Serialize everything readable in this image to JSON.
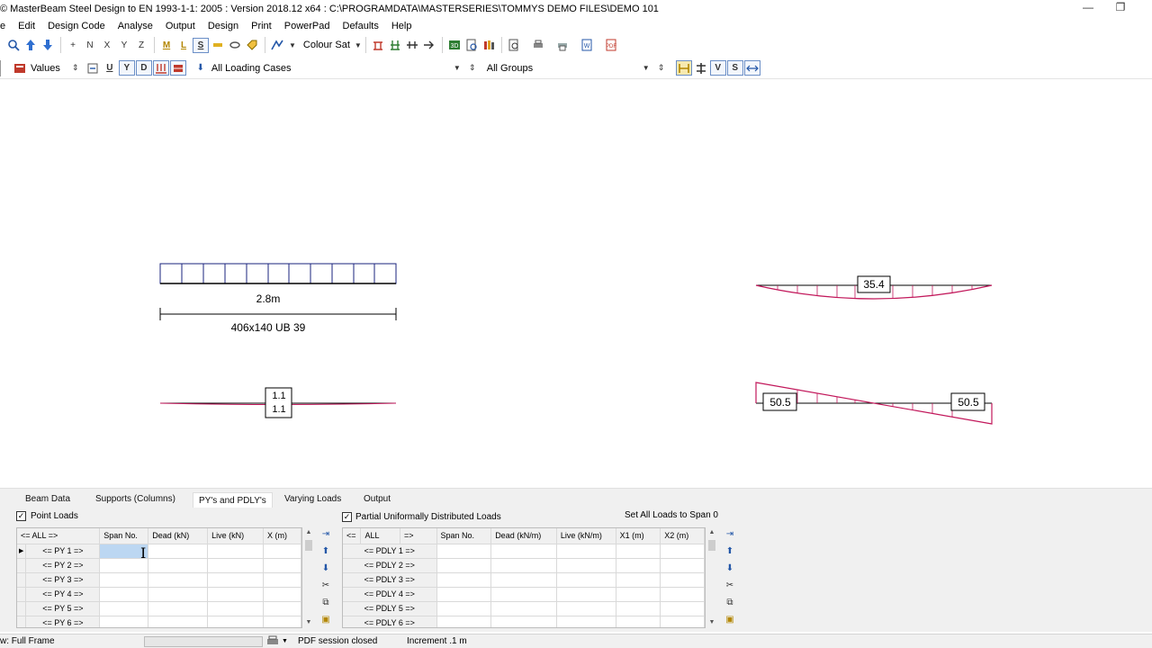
{
  "window": {
    "title": "© MasterBeam Steel Design to EN 1993-1-1: 2005 : Version 2018.12 x64 : C:\\PROGRAMDATA\\MASTERSERIES\\TOMMYS DEMO FILES\\DEMO 101",
    "minimize": "—",
    "restore": "❐"
  },
  "menu": [
    "e",
    "Edit",
    "Design Code",
    "Analyse",
    "Output",
    "Design",
    "Print",
    "PowerPad",
    "Defaults",
    "Help"
  ],
  "toolbar1": {
    "items_text": [
      "+",
      "N",
      "X",
      "Y",
      "Z",
      "M",
      "L",
      "S"
    ],
    "colour_label": "Colour Sat"
  },
  "toolbar2": {
    "values_label": "Values",
    "u": "U",
    "y": "Y",
    "d": "D",
    "loading_cases": "All Loading Cases",
    "groups": "All Groups",
    "v": "V",
    "s": "S"
  },
  "drawing": {
    "span_length": "2.8m",
    "section": "406x140 UB 39",
    "reaction_top": "1.1",
    "reaction_bottom": "1.1",
    "moment_max": "35.4",
    "shear_left": "50.5",
    "shear_right": "50.5"
  },
  "tabs": [
    "Beam Data",
    "Supports (Columns)",
    "PY's and PDLY's",
    "Varying Loads",
    "Output"
  ],
  "point_loads": {
    "title": "Point Loads",
    "checked": true,
    "headers": [
      "<= ALL =>",
      "Span No.",
      "Dead (kN)",
      "Live (kN)",
      "X (m)"
    ],
    "rows": [
      "<= PY   1 =>",
      "<= PY   2 =>",
      "<= PY   3 =>",
      "<= PY   4 =>",
      "<= PY   5 =>",
      "<= PY   6 =>"
    ]
  },
  "pudl": {
    "title": "Partial Uniformally Distributed Loads",
    "checked": true,
    "set_all": "Set All Loads to Span 0",
    "headers": [
      "<=",
      "ALL",
      "=>",
      "Span No.",
      "Dead (kN/m)",
      "Live (kN/m)",
      "X1 (m)",
      "X2 (m)"
    ],
    "rows": [
      "<= PDLY   1 =>",
      "<= PDLY   2 =>",
      "<= PDLY   3 =>",
      "<= PDLY   4 =>",
      "<= PDLY   5 =>",
      "<= PDLY   6 =>"
    ]
  },
  "status": {
    "view": "w: Full Frame",
    "pdf": "PDF session closed",
    "increment": "Increment .1 m"
  },
  "colors": {
    "beam_blue": "#1a237e",
    "diagram_red": "#c2185b",
    "selection": "#bcd7f2"
  }
}
